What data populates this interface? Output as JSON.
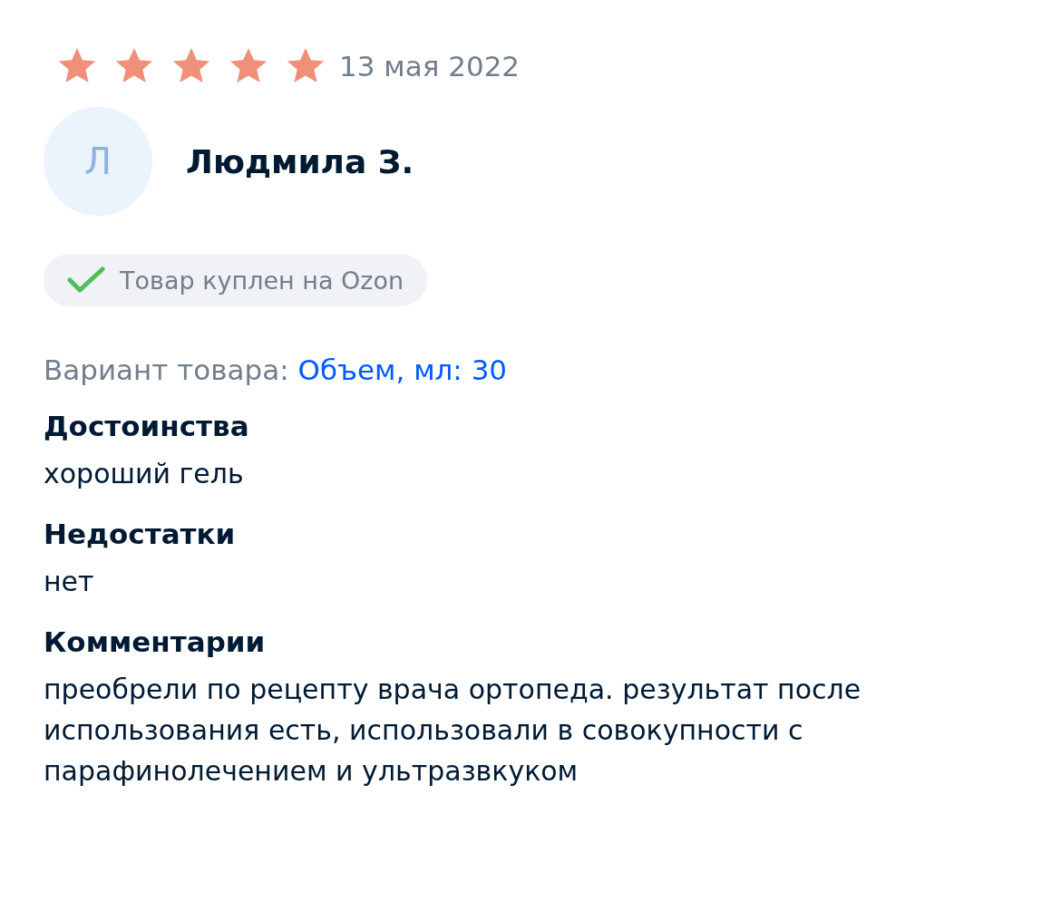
{
  "review": {
    "stars": 5,
    "date": "13 мая 2022",
    "author": {
      "initial": "Л",
      "name": "Людмила З."
    },
    "badge": {
      "verified": true,
      "label": "Товар куплен на Ozon"
    },
    "variant": {
      "label": "Вариант товара:",
      "value": "Объем, мл: 30"
    },
    "sections": [
      {
        "heading": "Достоинства",
        "text": "хороший гель"
      },
      {
        "heading": "Недостатки",
        "text": "нет"
      },
      {
        "heading": "Комментарии",
        "text": "преобрели по рецепту врача ортопеда. результат после использования есть, использовали в совокупности с парафинолечением и ультразвкуком"
      }
    ]
  }
}
